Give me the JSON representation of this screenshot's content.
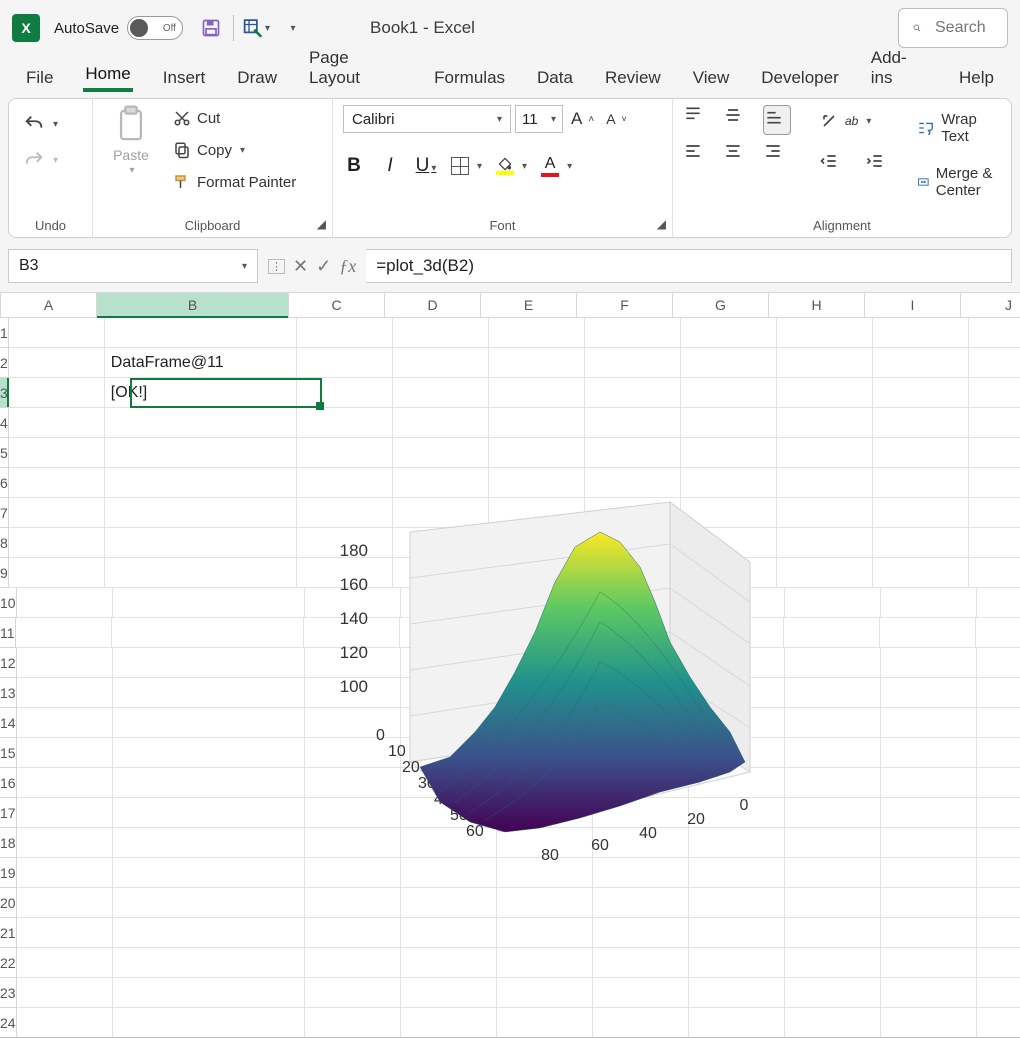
{
  "app": {
    "title": "Book1  -  Excel",
    "autosave_label": "AutoSave",
    "autosave_state": "Off",
    "search_placeholder": "Search"
  },
  "tabs": [
    "File",
    "Home",
    "Insert",
    "Draw",
    "Page Layout",
    "Formulas",
    "Data",
    "Review",
    "View",
    "Developer",
    "Add-ins",
    "Help"
  ],
  "active_tab": "Home",
  "ribbon": {
    "undo": {
      "label": "Undo"
    },
    "clipboard": {
      "paste": "Paste",
      "cut": "Cut",
      "copy": "Copy",
      "format_painter": "Format Painter",
      "label": "Clipboard"
    },
    "font": {
      "name": "Calibri",
      "size": "11",
      "label": "Font",
      "increase": "A^",
      "decrease": "A˅",
      "bold": "B",
      "italic": "I",
      "underline": "U"
    },
    "alignment": {
      "label": "Alignment",
      "wrap": "Wrap Text",
      "merge": "Merge & Center"
    }
  },
  "namebox": "B3",
  "formula": "=plot_3d(B2)",
  "columns": [
    "A",
    "B",
    "C",
    "D",
    "E",
    "F",
    "G",
    "H",
    "I",
    "J"
  ],
  "selected_col": "B",
  "selected_row": 3,
  "rows": 24,
  "cells": {
    "B2": "DataFrame@11",
    "B3": "[OK!]"
  },
  "chart_data": {
    "type": "surface3d",
    "description": "3D surface (terrain-like) rendered by plot_3d(B2)",
    "x_range": [
      0,
      80
    ],
    "x_ticks": [
      80,
      60,
      40,
      20,
      0
    ],
    "y_range": [
      0,
      60
    ],
    "y_ticks": [
      0,
      10,
      20,
      30,
      40,
      50,
      60
    ],
    "z_range": [
      100,
      180
    ],
    "z_ticks": [
      100,
      120,
      140,
      160,
      180
    ],
    "colormap": "viridis",
    "z_peak_approx": 185,
    "z_floor_approx": 95
  }
}
